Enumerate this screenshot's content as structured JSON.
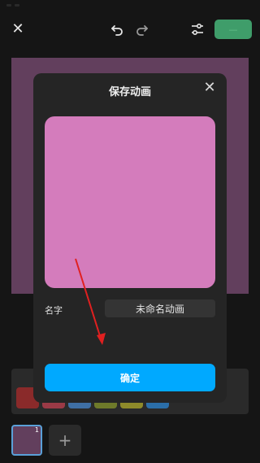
{
  "colors": {
    "background": "#151515",
    "canvas": "#623f5d",
    "preview": "#d47cbc",
    "modal": "#252525",
    "accent_save": "#3f9d6a",
    "confirm_button": "#00a9ff",
    "annotation_arrow": "#e02020"
  },
  "toolbar": {
    "close_icon": "close-icon",
    "undo_icon": "undo-icon",
    "redo_icon": "redo-icon",
    "settings_icon": "sliders-icon",
    "save_label": "—"
  },
  "dialog": {
    "title": "保存动画",
    "close_icon": "close-icon",
    "name_label": "名字",
    "name_value": "未命名动画",
    "confirm_label": "确定"
  },
  "palette": {
    "swatches": [
      "#8a2a2a",
      "#9b3a46",
      "#3f6fa4",
      "#6e7a2a",
      "#8e8a2a",
      "#2b6ea8"
    ]
  },
  "frames": {
    "items": [
      {
        "number": "1"
      }
    ],
    "add_label": "+"
  }
}
